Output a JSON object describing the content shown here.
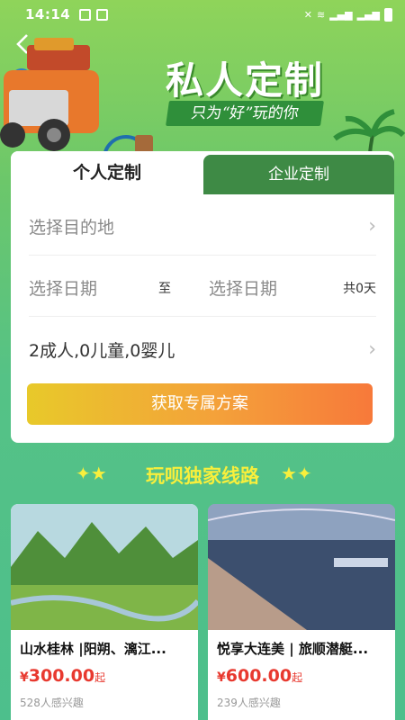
{
  "status_bar": {
    "time": "14:14",
    "icons_left": [
      "image-icon",
      "check-box-icon"
    ],
    "icons_right": [
      "mute-icon",
      "wifi-icon",
      "4g-signal-icon",
      "4g-signal-icon",
      "battery-icon"
    ]
  },
  "header": {
    "back_icon": "chevron-left-icon",
    "title": "私人定制",
    "subtitle": "只为“好”玩的你"
  },
  "tabs": [
    {
      "label": "个人定制",
      "active": true
    },
    {
      "label": "企业定制",
      "active": false
    }
  ],
  "form": {
    "destination_placeholder": "选择目的地",
    "start_date_placeholder": "选择日期",
    "to_label": "至",
    "end_date_placeholder": "选择日期",
    "days_text": "共0天",
    "passengers": "2成人,0儿童,0婴儿",
    "submit_label": "获取专属方案"
  },
  "section": {
    "title": "玩呗独家线路"
  },
  "tours": [
    {
      "name": "山水桂林 |阳朔、漓江...",
      "currency": "¥",
      "price": "300.00",
      "price_suffix": "起",
      "interest": "528人感兴趣"
    },
    {
      "name": "悦享大连美 | 旅顺潜艇...",
      "currency": "¥",
      "price": "600.00",
      "price_suffix": "起",
      "interest": "239人感兴趣"
    }
  ],
  "colors": {
    "accent_green": "#3e8a45",
    "price_red": "#e8392f",
    "title_yellow": "#f8ef3c"
  }
}
